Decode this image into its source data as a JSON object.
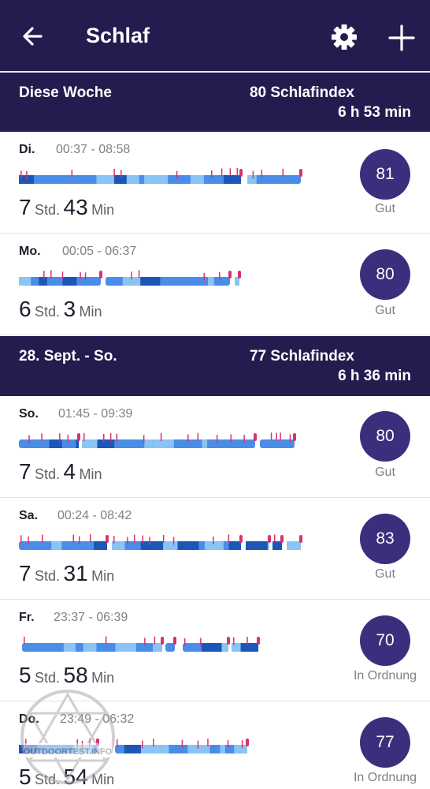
{
  "header": {
    "title": "Schlaf",
    "icons": {
      "back": "arrow-left-icon",
      "settings": "gear-icon",
      "add": "plus-icon"
    }
  },
  "weeks": [
    {
      "range": "Diese Woche",
      "score_text": "80 Schlafindex",
      "average_text": "6 h 53 min",
      "entries": [
        {
          "day": "Di.",
          "time": "00:37 - 08:58",
          "hours": "7",
          "hours_unit": "Std.",
          "minutes": "43",
          "minutes_unit": "Min",
          "score": "81",
          "rating": "Gut"
        },
        {
          "day": "Mo.",
          "time": "00:05 - 06:37",
          "hours": "6",
          "hours_unit": "Std.",
          "minutes": "3",
          "minutes_unit": "Min",
          "score": "80",
          "rating": "Gut"
        }
      ]
    },
    {
      "range": "28. Sept. - So.",
      "score_text": "77 Schlafindex",
      "average_text": "6 h 36 min",
      "entries": [
        {
          "day": "So.",
          "time": "01:45 - 09:39",
          "hours": "7",
          "hours_unit": "Std.",
          "minutes": "4",
          "minutes_unit": "Min",
          "score": "80",
          "rating": "Gut"
        },
        {
          "day": "Sa.",
          "time": "00:24 - 08:42",
          "hours": "7",
          "hours_unit": "Std.",
          "minutes": "31",
          "minutes_unit": "Min",
          "score": "83",
          "rating": "Gut"
        },
        {
          "day": "Fr.",
          "time": "23:37 - 06:39",
          "hours": "5",
          "hours_unit": "Std.",
          "minutes": "58",
          "minutes_unit": "Min",
          "score": "70",
          "rating": "In Ordnung"
        },
        {
          "day": "Do.",
          "time": "23:49 - 06:32",
          "hours": "5",
          "hours_unit": "Std.",
          "minutes": "54",
          "minutes_unit": "Min",
          "score": "77",
          "rating": "In Ordnung"
        }
      ]
    }
  ],
  "watermark": {
    "text": "OUTDOORTEST.INFO"
  },
  "colors": {
    "header_bg": "#241c4e",
    "badge": "#3d2e7d",
    "awake": "#d6336e",
    "rem": "#8ac4f6",
    "light": "#4a8de8",
    "deep": "#1c57b8"
  }
}
